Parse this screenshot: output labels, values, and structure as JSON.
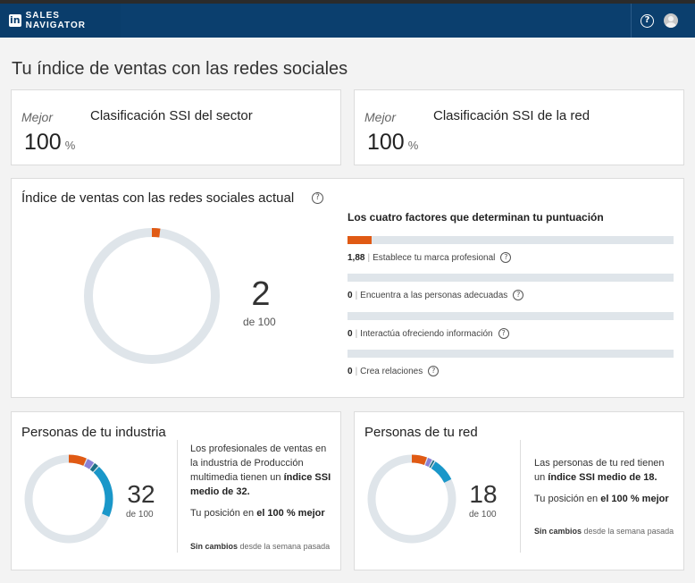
{
  "navbar": {
    "logo": "in",
    "brand": "SALES NAVIGATOR",
    "help_icon": "question-mark-circle-icon",
    "avatar_icon": "user-avatar-icon"
  },
  "page_title": "Tu índice de ventas con las redes sociales",
  "sector_card": {
    "mejor": "Mejor",
    "heading": "Clasificación SSI del sector",
    "value": "100",
    "unit": "%"
  },
  "network_card": {
    "mejor": "Mejor",
    "heading": "Clasificación SSI de la red",
    "value": "100",
    "unit": "%"
  },
  "current_ssi": {
    "title": "Índice de ventas con las redes sociales actual",
    "score": "2",
    "score_value": 2,
    "out_of": "de 100",
    "factors_title": "Los cuatro factores que determinan tu puntuación",
    "factors": [
      {
        "value": "1,88",
        "value_num": 1.88,
        "max": 25,
        "label": "Establece tu marca profesional"
      },
      {
        "value": "0",
        "value_num": 0,
        "max": 25,
        "label": "Encuentra a las personas adecuadas"
      },
      {
        "value": "0",
        "value_num": 0,
        "max": 25,
        "label": "Interactúa ofreciendo información"
      },
      {
        "value": "0",
        "value_num": 0,
        "max": 25,
        "label": "Crea relaciones"
      }
    ]
  },
  "industry": {
    "title": "Personas de tu industria",
    "score": "32",
    "out_of": "de 100",
    "text_1": "Los profesionales de ventas en la industria de Producción multimedia tienen un ",
    "text_1_bold": "índice SSI medio de 32.",
    "text_2": "Tu posición en ",
    "text_2_bold": "el 100 % mejor",
    "foot_bold": "Sin cambios",
    "foot_rest": " desde la semana pasada",
    "segments": [
      7,
      3,
      2,
      20
    ]
  },
  "network": {
    "title": "Personas de tu red",
    "score": "18",
    "out_of": "de 100",
    "text_1": "Las personas de tu red tienen un ",
    "text_1_bold": "índice SSI medio de 18.",
    "text_2": "Tu posición en ",
    "text_2_bold": "el 100 % mejor",
    "foot_bold": "Sin cambios",
    "foot_rest": " desde la semana pasada",
    "segments": [
      6,
      2,
      1,
      9
    ]
  },
  "colors": {
    "orange": "#e05a14",
    "purple": "#8a80d6",
    "teal": "#1e6f86",
    "blue": "#1a97c9",
    "track": "#dfe5ea",
    "navbar": "#0b3f6e"
  }
}
